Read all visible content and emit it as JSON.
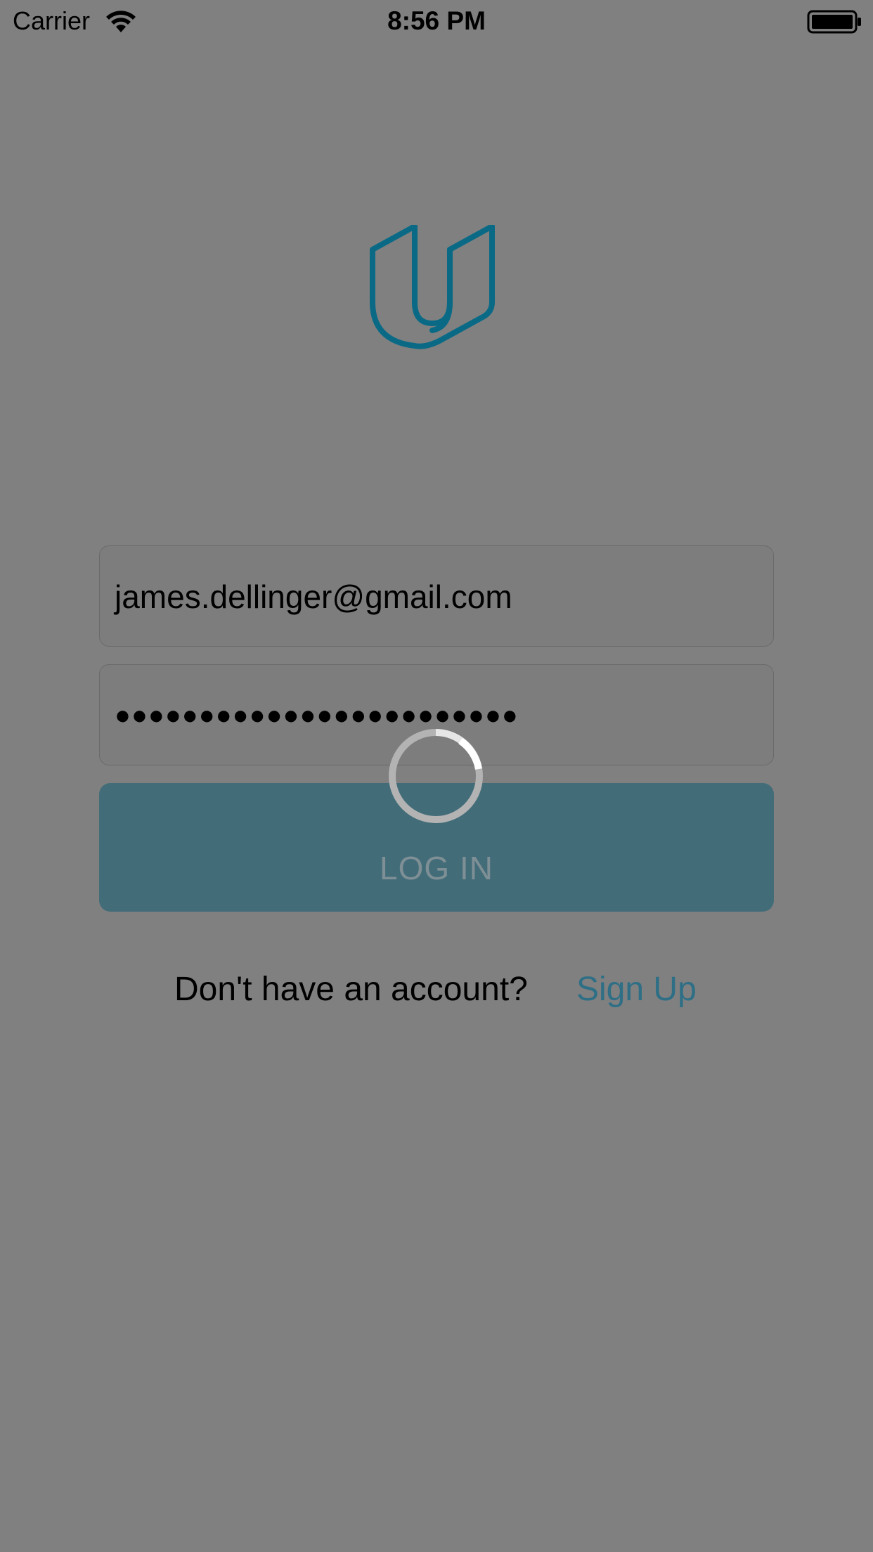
{
  "status_bar": {
    "carrier": "Carrier",
    "time": "8:56 PM",
    "wifi_icon": "wifi-icon",
    "battery_icon": "battery-full-icon"
  },
  "logo": {
    "icon": "udacity-logo-icon",
    "color": "#0a6a86"
  },
  "login_form": {
    "email_value": "james.dellinger@gmail.com",
    "password_masked": "●●●●●●●●●●●●●●●●●●●●●●●●",
    "login_label": "LOG IN",
    "login_button_color": "#436c79",
    "loading": true
  },
  "signup": {
    "prompt": "Don't have an account?",
    "link_label": "Sign Up",
    "link_color": "#2e6f86"
  },
  "overlay_color": "#808080"
}
